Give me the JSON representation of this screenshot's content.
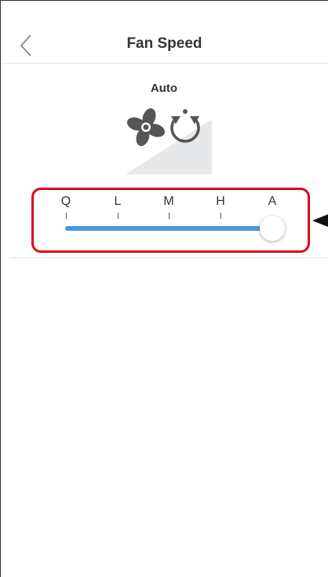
{
  "header": {
    "title": "Fan Speed",
    "back_icon": "chevron-left-icon"
  },
  "current_mode": {
    "label": "Auto",
    "icons": [
      "fan-icon",
      "auto-cycle-icon"
    ]
  },
  "slider": {
    "stops": [
      "Q",
      "L",
      "M",
      "H",
      "A"
    ],
    "selected": "A",
    "value_fraction": 1.0,
    "track_color": "#4a98df"
  },
  "annotation": {
    "highlight_color": "#e0001c"
  }
}
